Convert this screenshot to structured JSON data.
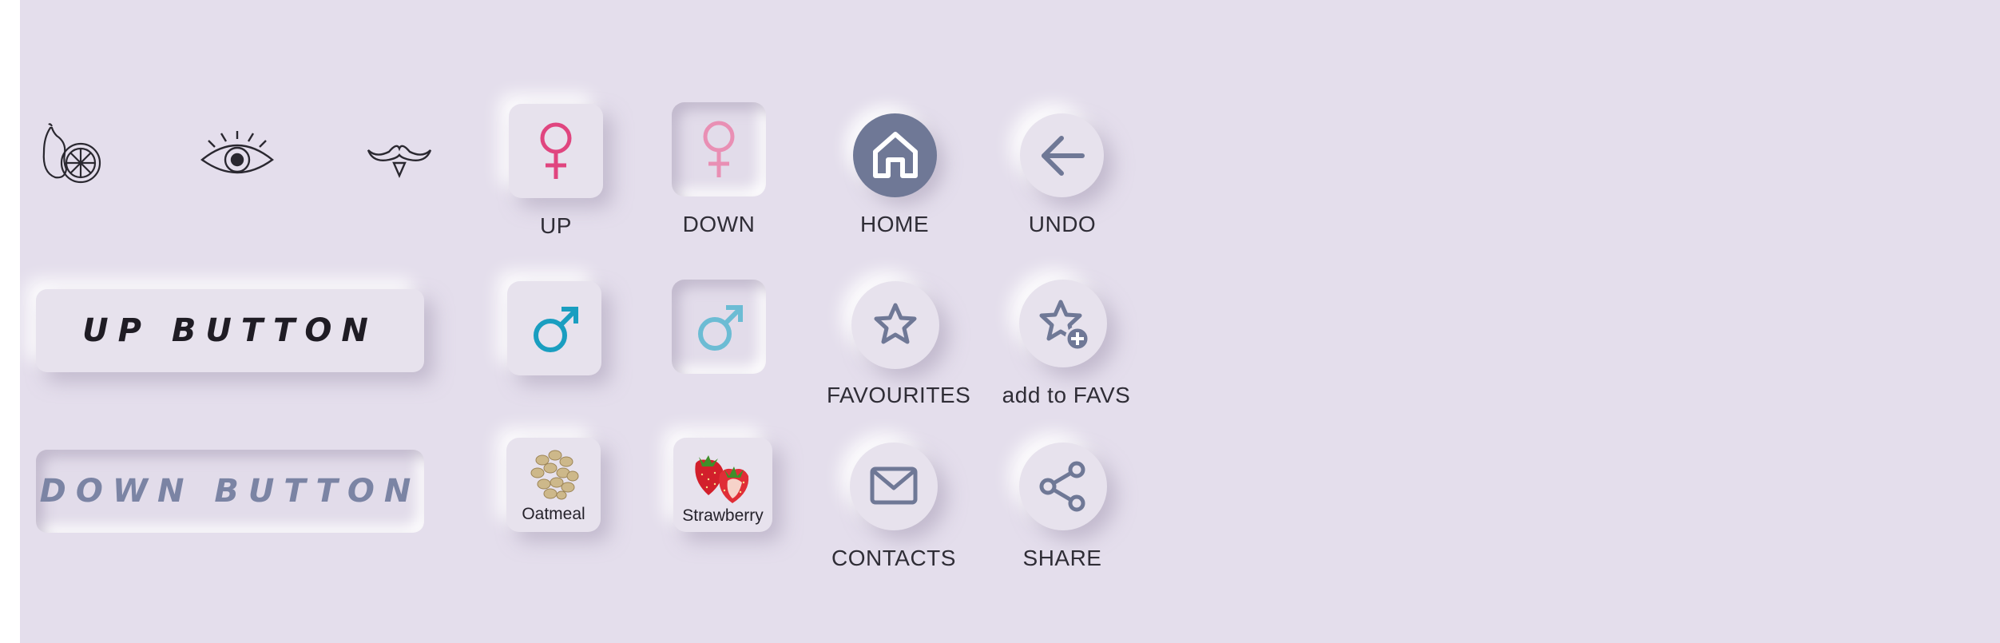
{
  "labels": {
    "up": "UP",
    "down": "DOWN",
    "home": "HOME",
    "undo": "UNDO",
    "favourites": "FAVOURITES",
    "add_to_favs": "add to FAVS",
    "contacts": "CONTACTS",
    "share": "SHARE"
  },
  "buttons": {
    "up_button": "UP BUTTON",
    "down_button": "DOWN BUTTON"
  },
  "foods": {
    "oatmeal": "Oatmeal",
    "strawberry": "Strawberry"
  },
  "icons": [
    "fruit-icon",
    "eye-icon",
    "mustache-icon",
    "female-icon",
    "male-icon",
    "home-icon",
    "arrow-left-icon",
    "star-icon",
    "star-add-icon",
    "mail-icon",
    "share-icon"
  ],
  "colors": {
    "background": "#e4deec",
    "female_pink": "#e0457f",
    "female_pink_light": "#e98fb4",
    "male_blue": "#1a9ec0",
    "male_blue_light": "#6cbcd4",
    "slate_icon": "#6f7896",
    "home_fill": "#6f7896",
    "down_text": "#7b84a4"
  }
}
